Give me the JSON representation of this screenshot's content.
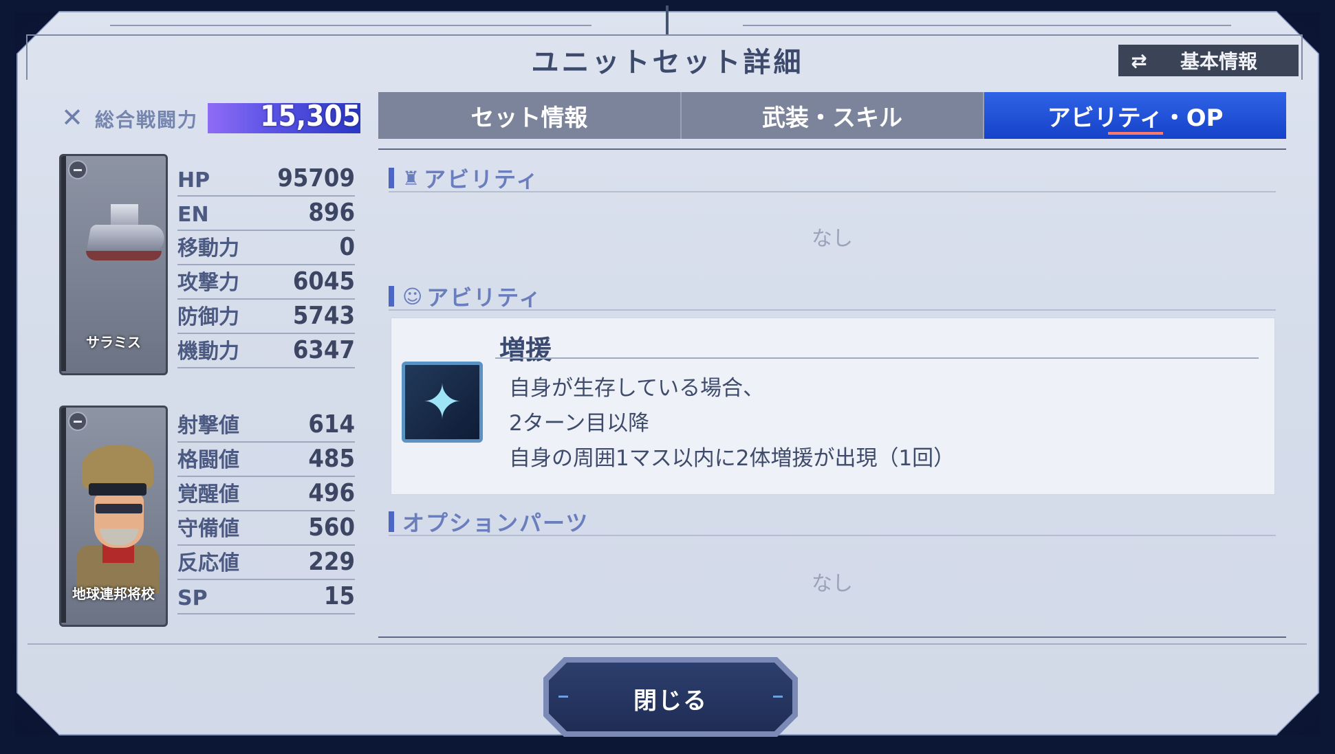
{
  "header": {
    "title": "ユニットセット詳細",
    "basic_info_label": "基本情報",
    "basic_info_icon": "shuffle-icon"
  },
  "combat_power": {
    "label": "総合戦闘力",
    "value": "15,305",
    "icon": "crossed-swords-icon"
  },
  "unit": {
    "name": "サラミス",
    "stats": [
      {
        "key": "HP",
        "value": "95709"
      },
      {
        "key": "EN",
        "value": "896"
      },
      {
        "key": "移動力",
        "value": "0"
      },
      {
        "key": "攻撃力",
        "value": "6045"
      },
      {
        "key": "防御力",
        "value": "5743"
      },
      {
        "key": "機動力",
        "value": "6347"
      }
    ]
  },
  "pilot": {
    "name": "地球連邦将校",
    "stats": [
      {
        "key": "射撃値",
        "value": "614"
      },
      {
        "key": "格闘値",
        "value": "485"
      },
      {
        "key": "覚醒値",
        "value": "496"
      },
      {
        "key": "守備値",
        "value": "560"
      },
      {
        "key": "反応値",
        "value": "229"
      },
      {
        "key": "SP",
        "value": "15"
      }
    ]
  },
  "tabs": [
    {
      "label": "セット情報",
      "active": false
    },
    {
      "label": "武装・スキル",
      "active": false
    },
    {
      "label": "アビリティ・OP",
      "active": true
    }
  ],
  "sections": {
    "unit_ability": {
      "title": "アビリティ",
      "icon": "mech-head-icon",
      "empty_text": "なし"
    },
    "pilot_ability": {
      "title": "アビリティ",
      "icon": "pilot-head-icon"
    },
    "option_parts": {
      "title": "オプションパーツ",
      "empty_text": "なし"
    }
  },
  "ability": {
    "name": "増援",
    "icon": "reinforcement-icon",
    "description_lines": [
      "自身が生存している場合、",
      "2ターン目以降",
      "自身の周囲1マス以内に2体増援が出現（1回）"
    ]
  },
  "footer": {
    "close_label": "閉じる"
  },
  "colors": {
    "active_tab": "#1542c9",
    "accent_underline": "#ff7a6a",
    "section_title": "#6a7dbd"
  }
}
